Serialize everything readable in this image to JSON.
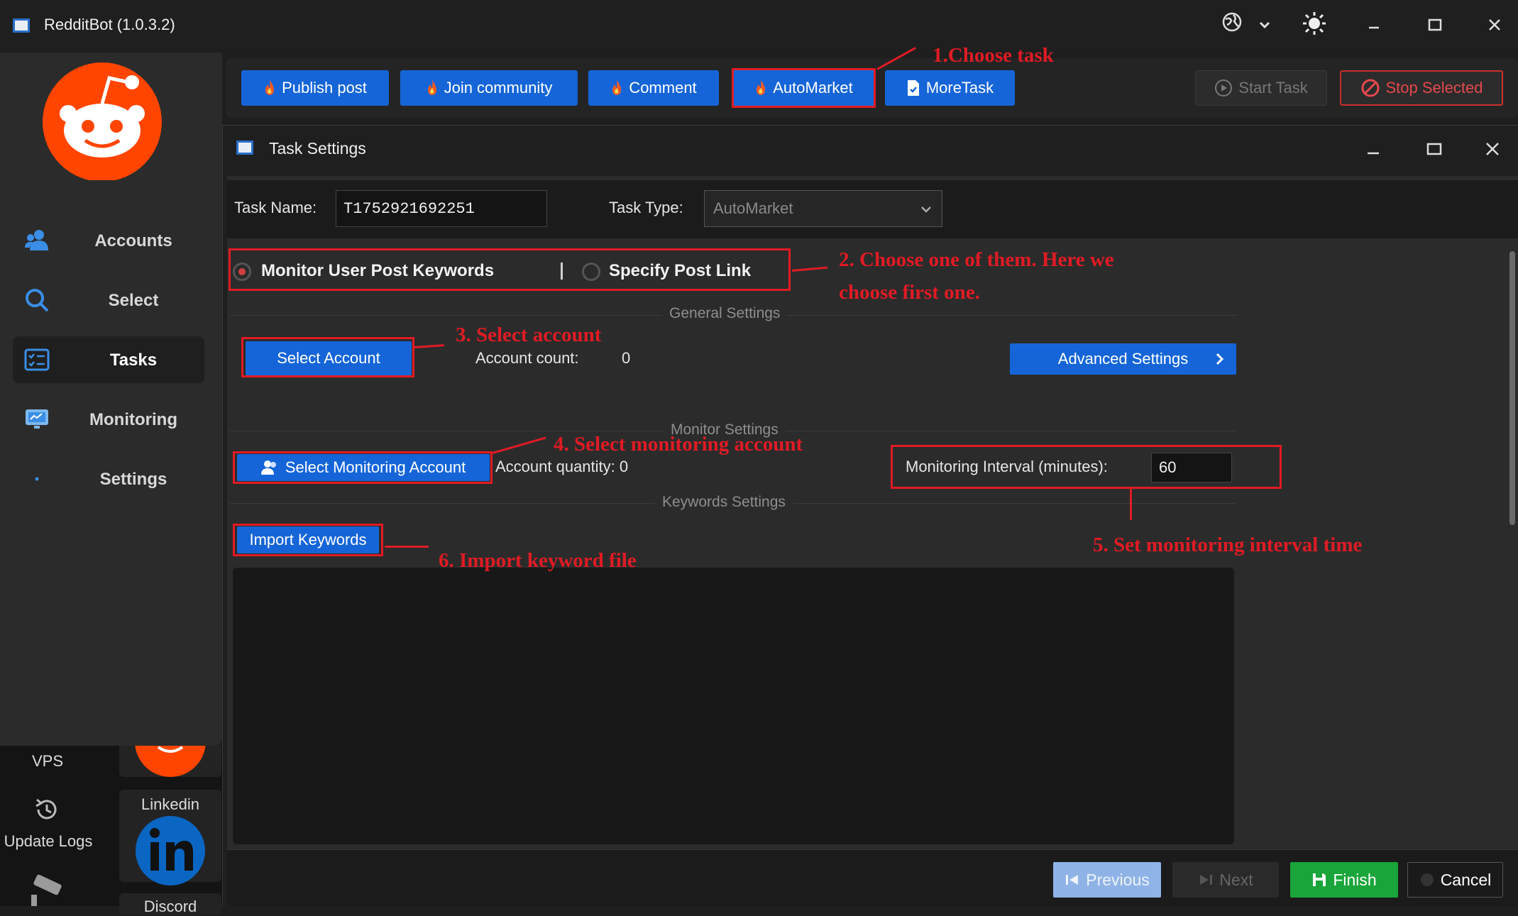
{
  "window": {
    "title": "RedditBot (1.0.3.2)",
    "controls": [
      "globe-icon",
      "chevron-down-icon",
      "sun-icon",
      "minimize-icon",
      "maximize-icon",
      "close-icon"
    ]
  },
  "sidebar": {
    "items": [
      {
        "label": "Accounts",
        "icon": "accounts-icon"
      },
      {
        "label": "Select",
        "icon": "search-icon"
      },
      {
        "label": "Tasks",
        "icon": "tasks-icon",
        "active": true
      },
      {
        "label": "Monitoring",
        "icon": "monitor-icon"
      },
      {
        "label": "Settings",
        "icon": "dot-icon"
      }
    ]
  },
  "dock": {
    "vps": "VPS",
    "update_logs": "Update Logs",
    "linkedin": "Linkedin",
    "discord": "Discord"
  },
  "taskbar": {
    "buttons": [
      "Publish post",
      "Join community",
      "Comment",
      "AutoMarket",
      "MoreTask"
    ],
    "start_task": "Start Task",
    "stop_selected": "Stop Selected"
  },
  "dialog": {
    "title": "Task Settings",
    "task_name_label": "Task Name:",
    "task_name_value": "T1752921692251",
    "task_type_label": "Task Type:",
    "task_type_value": "AutoMarket",
    "radio_monitor": "Monitor User Post Keywords",
    "radio_specify": "Specify Post Link",
    "general_settings": "General Settings",
    "select_account": "Select Account",
    "account_count_label": "Account count:",
    "account_count_value": "0",
    "advanced_settings": "Advanced Settings",
    "monitor_settings": "Monitor Settings",
    "select_monitoring_account": "Select Monitoring Account",
    "account_quantity": "Account quantity: 0",
    "monitoring_interval_label": "Monitoring Interval (minutes):",
    "monitoring_interval_value": "60",
    "keywords_settings": "Keywords Settings",
    "import_keywords": "Import Keywords",
    "footer": {
      "previous": "Previous",
      "next": "Next",
      "finish": "Finish",
      "cancel": "Cancel"
    }
  },
  "annotations": {
    "a1": "1.Choose task",
    "a2_line1": "2. Choose one of them. Here we",
    "a2_line2": "choose first one.",
    "a3": "3. Select account",
    "a4": "4. Select monitoring account",
    "a5": "5. Set monitoring interval time",
    "a6": "6. Import keyword file"
  },
  "colors": {
    "accent_blue": "#1565d8",
    "annotation_red": "#e01b24",
    "finish_green": "#1aa53a",
    "reddit_orange": "#ff4500"
  }
}
